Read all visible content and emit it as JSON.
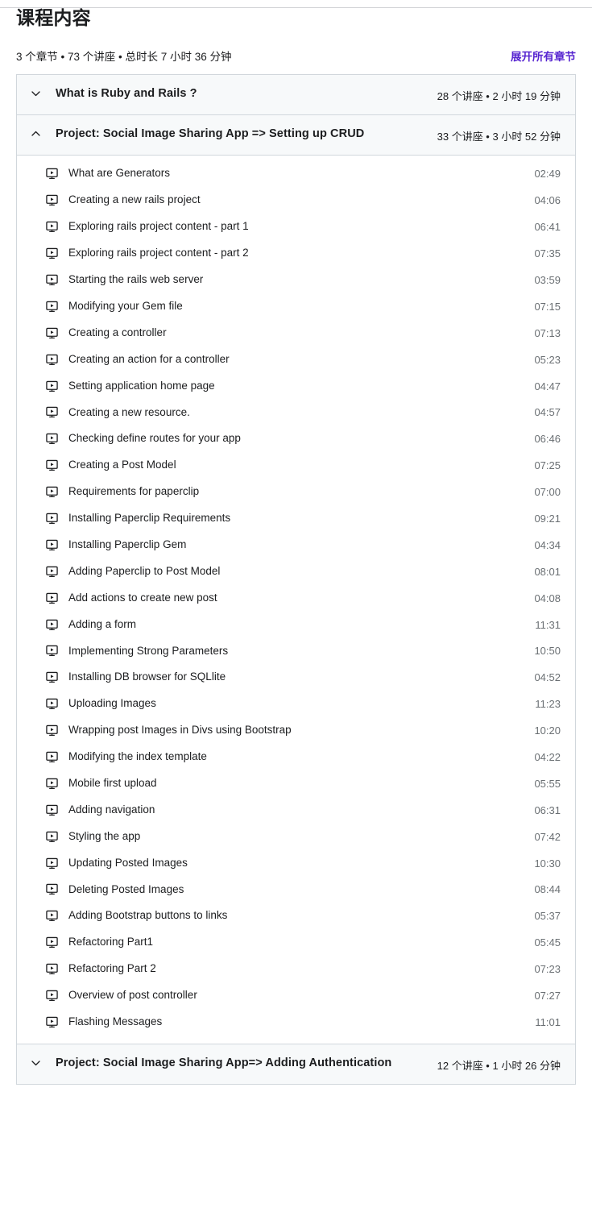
{
  "header": {
    "title": "课程内容",
    "summary": "3 个章节 • 73 个讲座 • 总时长 7 小时 36 分钟",
    "expand_all_label": "展开所有章节",
    "accent_color": "#5624d0"
  },
  "sections": [
    {
      "title": "What is Ruby and Rails ?",
      "meta": "28 个讲座 • 2 小时 19 分钟",
      "expanded": false,
      "chevron_icon": "chevron-down-icon",
      "lectures": []
    },
    {
      "title": "Project: Social Image Sharing App => Setting up CRUD",
      "meta": "33 个讲座 • 3 小时 52 分钟",
      "expanded": true,
      "chevron_icon": "chevron-up-icon",
      "lectures": [
        {
          "title": "What are Generators",
          "duration": "02:49",
          "icon": "video-icon"
        },
        {
          "title": "Creating a new rails project",
          "duration": "04:06",
          "icon": "video-icon"
        },
        {
          "title": "Exploring rails project content - part 1",
          "duration": "06:41",
          "icon": "video-icon"
        },
        {
          "title": "Exploring rails project content - part 2",
          "duration": "07:35",
          "icon": "video-icon"
        },
        {
          "title": "Starting the rails web server",
          "duration": "03:59",
          "icon": "video-icon"
        },
        {
          "title": "Modifying your Gem file",
          "duration": "07:15",
          "icon": "video-icon"
        },
        {
          "title": "Creating a controller",
          "duration": "07:13",
          "icon": "video-icon"
        },
        {
          "title": "Creating an action for a controller",
          "duration": "05:23",
          "icon": "video-icon"
        },
        {
          "title": "Setting application home page",
          "duration": "04:47",
          "icon": "video-icon"
        },
        {
          "title": "Creating a new resource.",
          "duration": "04:57",
          "icon": "video-icon"
        },
        {
          "title": "Checking define routes for your app",
          "duration": "06:46",
          "icon": "video-icon"
        },
        {
          "title": "Creating a Post Model",
          "duration": "07:25",
          "icon": "video-icon"
        },
        {
          "title": "Requirements for paperclip",
          "duration": "07:00",
          "icon": "video-icon"
        },
        {
          "title": "Installing Paperclip Requirements",
          "duration": "09:21",
          "icon": "video-icon"
        },
        {
          "title": "Installing Paperclip Gem",
          "duration": "04:34",
          "icon": "video-icon"
        },
        {
          "title": "Adding Paperclip to Post Model",
          "duration": "08:01",
          "icon": "video-icon"
        },
        {
          "title": "Add actions to create new post",
          "duration": "04:08",
          "icon": "video-icon"
        },
        {
          "title": "Adding a form",
          "duration": "11:31",
          "icon": "video-icon"
        },
        {
          "title": "Implementing Strong Parameters",
          "duration": "10:50",
          "icon": "video-icon"
        },
        {
          "title": "Installing DB browser for SQLlite",
          "duration": "04:52",
          "icon": "video-icon"
        },
        {
          "title": "Uploading Images",
          "duration": "11:23",
          "icon": "video-icon"
        },
        {
          "title": "Wrapping post Images in Divs using Bootstrap",
          "duration": "10:20",
          "icon": "video-icon"
        },
        {
          "title": "Modifying the index template",
          "duration": "04:22",
          "icon": "video-icon"
        },
        {
          "title": "Mobile first upload",
          "duration": "05:55",
          "icon": "video-icon"
        },
        {
          "title": "Adding navigation",
          "duration": "06:31",
          "icon": "video-icon"
        },
        {
          "title": "Styling the app",
          "duration": "07:42",
          "icon": "video-icon"
        },
        {
          "title": "Updating Posted Images",
          "duration": "10:30",
          "icon": "video-icon"
        },
        {
          "title": "Deleting Posted Images",
          "duration": "08:44",
          "icon": "video-icon"
        },
        {
          "title": "Adding Bootstrap buttons to links",
          "duration": "05:37",
          "icon": "video-icon"
        },
        {
          "title": "Refactoring Part1",
          "duration": "05:45",
          "icon": "video-icon"
        },
        {
          "title": "Refactoring Part 2",
          "duration": "07:23",
          "icon": "video-icon"
        },
        {
          "title": "Overview of post controller",
          "duration": "07:27",
          "icon": "video-icon"
        },
        {
          "title": "Flashing Messages",
          "duration": "11:01",
          "icon": "video-icon"
        }
      ]
    },
    {
      "title": "Project: Social Image Sharing App=> Adding Authentication",
      "meta": "12 个讲座 • 1 小时 26 分钟",
      "expanded": false,
      "chevron_icon": "chevron-down-icon",
      "lectures": []
    }
  ]
}
